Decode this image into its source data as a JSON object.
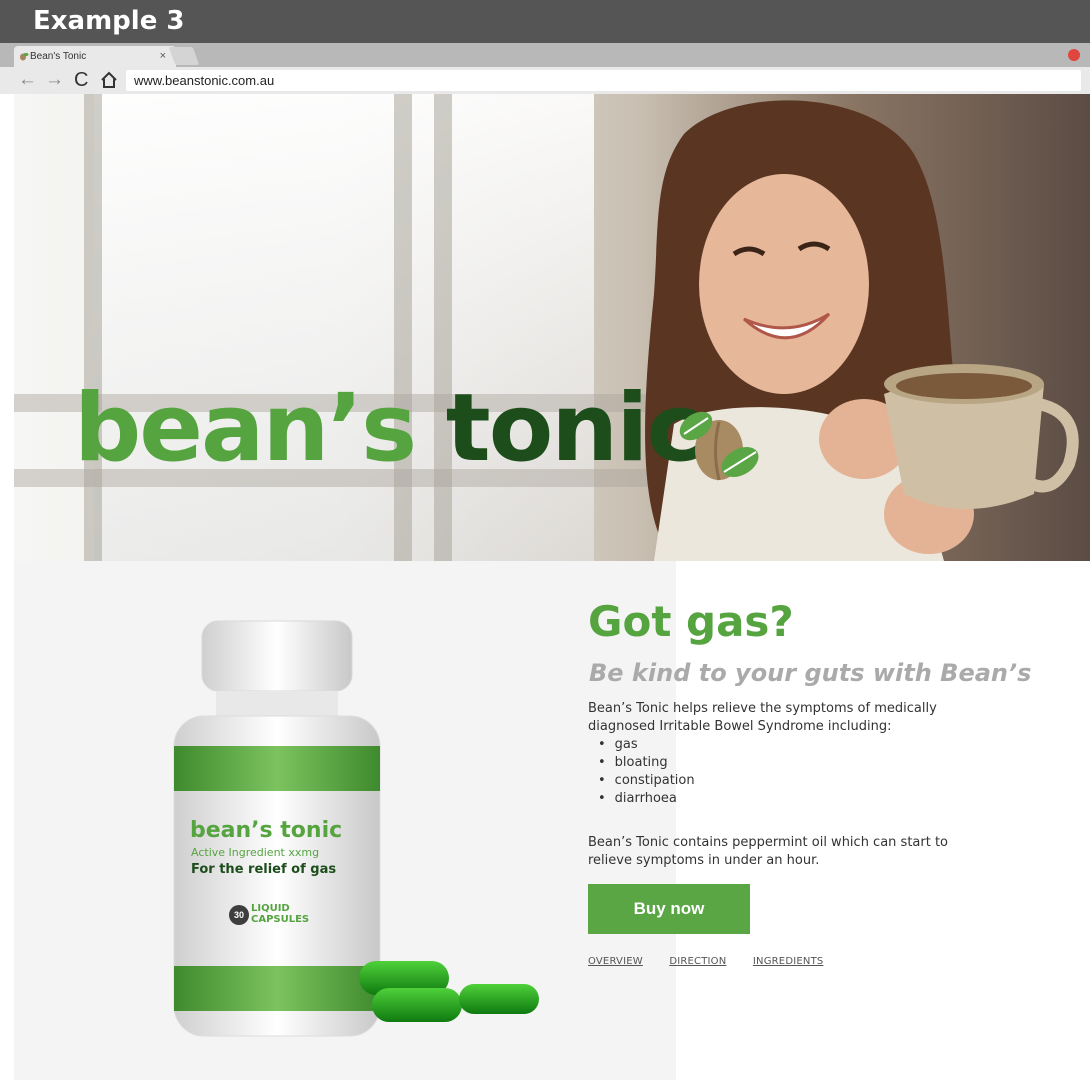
{
  "example_label": "Example 3",
  "browser": {
    "tab_title": "Bean's Tonic",
    "tab_close": "×",
    "url": "www.beanstonic.com.au",
    "nav": {
      "back": "←",
      "forward": "→",
      "reload": "C",
      "home": "⌂"
    }
  },
  "hero": {
    "logo_part1": "bean’s",
    "logo_part2": "tonic"
  },
  "product": {
    "label_brand": "bean’s tonic",
    "label_active": "Active Ingredient xxmg",
    "label_relief": "For the relief of gas",
    "label_count": "30",
    "label_capsules_line1": "LIQUID",
    "label_capsules_line2": "CAPSULES"
  },
  "content": {
    "headline": "Got gas?",
    "subheadline": "Be kind to your guts with Bean’s",
    "intro": "Bean’s Tonic helps relieve the symptoms of medically diagnosed Irritable Bowel Syndrome including:",
    "symptoms": [
      "gas",
      "bloating",
      "constipation",
      "diarrhoea"
    ],
    "detail": "Bean’s Tonic contains peppermint oil which can start to relieve symptoms in under an hour.",
    "buy_label": "Buy now",
    "links": [
      "OVERVIEW",
      "DIRECTION",
      "INGREDIENTS"
    ]
  },
  "colors": {
    "brand_green": "#55a440",
    "dark_green": "#1e4d1c",
    "button_green": "#5aa544",
    "header_gray": "#555555"
  }
}
